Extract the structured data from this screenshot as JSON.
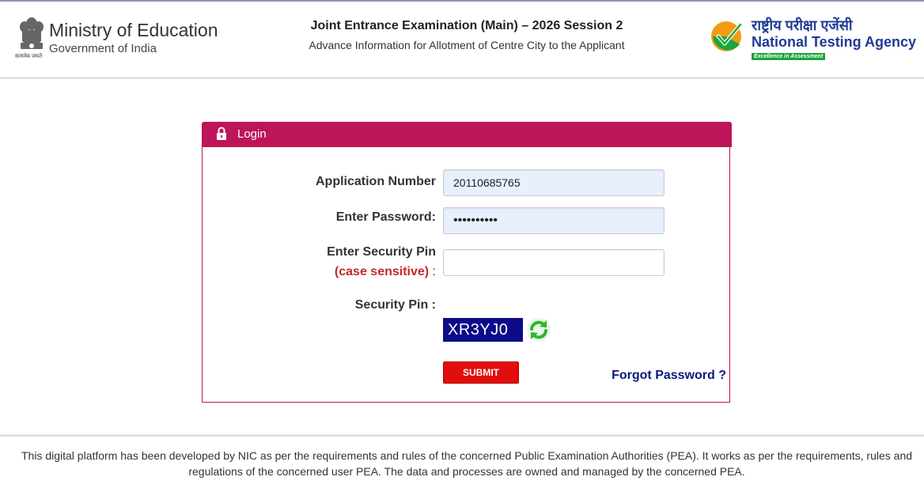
{
  "header": {
    "moe_title": "Ministry of Education",
    "moe_subtitle": "Government of India",
    "emblem_motto": "सत्यमेव जयते",
    "exam_title": "Joint Entrance Examination (Main) – 2026 Session 2",
    "exam_subtitle": "Advance Information for Allotment of Centre City to the Applicant",
    "nta_hindi": "राष्ट्रीय परीक्षा एजेंसी",
    "nta_name": "National Testing Agency",
    "nta_tagline": "Excellence in Assessment"
  },
  "login": {
    "title": "Login",
    "lock_icon": "lock-icon",
    "application_label": "Application Number",
    "application_value": "20110685765",
    "password_label": "Enter Password:",
    "password_value": "••••••••••",
    "security_pin_label": "Enter Security Pin",
    "case_note": "(case sensitive)",
    "case_colon": " :",
    "security_pin_value": "",
    "captcha_label": "Security Pin :",
    "captcha_text": "XR3YJ0",
    "refresh_icon": "refresh-icon",
    "submit_label": "SUBMIT",
    "forgot_label": "Forgot Password ?"
  },
  "footer": {
    "text": "This digital platform has been developed by NIC as per the requirements and rules of the concerned Public Examination Authorities (PEA). It works as per the requirements, rules and regulations of the concerned user PEA. The data and processes are owned and managed by the concerned PEA."
  },
  "colors": {
    "accent": "#bd1557",
    "submit": "#e30d0d",
    "captcha_bg": "#0b0b8a",
    "link": "#0a1a78",
    "nta_blue": "#1f3a93",
    "nta_green": "#1aa53d"
  }
}
